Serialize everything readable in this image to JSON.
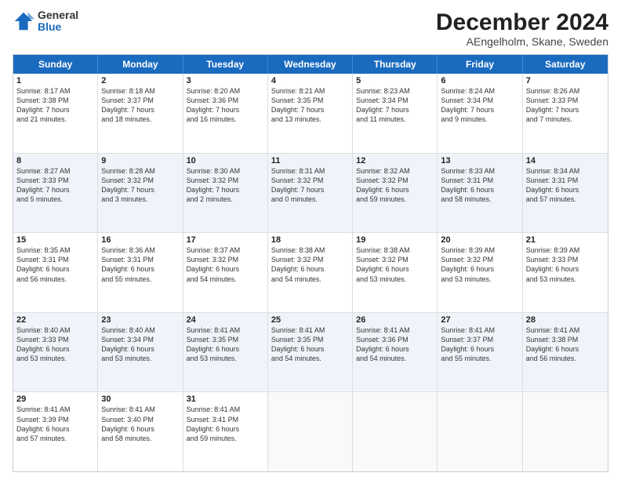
{
  "logo": {
    "general": "General",
    "blue": "Blue"
  },
  "title": "December 2024",
  "subtitle": "AEngelholm, Skane, Sweden",
  "header_days": [
    "Sunday",
    "Monday",
    "Tuesday",
    "Wednesday",
    "Thursday",
    "Friday",
    "Saturday"
  ],
  "weeks": [
    [
      {
        "day": "1",
        "lines": [
          "Sunrise: 8:17 AM",
          "Sunset: 3:38 PM",
          "Daylight: 7 hours",
          "and 21 minutes."
        ]
      },
      {
        "day": "2",
        "lines": [
          "Sunrise: 8:18 AM",
          "Sunset: 3:37 PM",
          "Daylight: 7 hours",
          "and 18 minutes."
        ]
      },
      {
        "day": "3",
        "lines": [
          "Sunrise: 8:20 AM",
          "Sunset: 3:36 PM",
          "Daylight: 7 hours",
          "and 16 minutes."
        ]
      },
      {
        "day": "4",
        "lines": [
          "Sunrise: 8:21 AM",
          "Sunset: 3:35 PM",
          "Daylight: 7 hours",
          "and 13 minutes."
        ]
      },
      {
        "day": "5",
        "lines": [
          "Sunrise: 8:23 AM",
          "Sunset: 3:34 PM",
          "Daylight: 7 hours",
          "and 11 minutes."
        ]
      },
      {
        "day": "6",
        "lines": [
          "Sunrise: 8:24 AM",
          "Sunset: 3:34 PM",
          "Daylight: 7 hours",
          "and 9 minutes."
        ]
      },
      {
        "day": "7",
        "lines": [
          "Sunrise: 8:26 AM",
          "Sunset: 3:33 PM",
          "Daylight: 7 hours",
          "and 7 minutes."
        ]
      }
    ],
    [
      {
        "day": "8",
        "lines": [
          "Sunrise: 8:27 AM",
          "Sunset: 3:33 PM",
          "Daylight: 7 hours",
          "and 5 minutes."
        ]
      },
      {
        "day": "9",
        "lines": [
          "Sunrise: 8:28 AM",
          "Sunset: 3:32 PM",
          "Daylight: 7 hours",
          "and 3 minutes."
        ]
      },
      {
        "day": "10",
        "lines": [
          "Sunrise: 8:30 AM",
          "Sunset: 3:32 PM",
          "Daylight: 7 hours",
          "and 2 minutes."
        ]
      },
      {
        "day": "11",
        "lines": [
          "Sunrise: 8:31 AM",
          "Sunset: 3:32 PM",
          "Daylight: 7 hours",
          "and 0 minutes."
        ]
      },
      {
        "day": "12",
        "lines": [
          "Sunrise: 8:32 AM",
          "Sunset: 3:32 PM",
          "Daylight: 6 hours",
          "and 59 minutes."
        ]
      },
      {
        "day": "13",
        "lines": [
          "Sunrise: 8:33 AM",
          "Sunset: 3:31 PM",
          "Daylight: 6 hours",
          "and 58 minutes."
        ]
      },
      {
        "day": "14",
        "lines": [
          "Sunrise: 8:34 AM",
          "Sunset: 3:31 PM",
          "Daylight: 6 hours",
          "and 57 minutes."
        ]
      }
    ],
    [
      {
        "day": "15",
        "lines": [
          "Sunrise: 8:35 AM",
          "Sunset: 3:31 PM",
          "Daylight: 6 hours",
          "and 56 minutes."
        ]
      },
      {
        "day": "16",
        "lines": [
          "Sunrise: 8:36 AM",
          "Sunset: 3:31 PM",
          "Daylight: 6 hours",
          "and 55 minutes."
        ]
      },
      {
        "day": "17",
        "lines": [
          "Sunrise: 8:37 AM",
          "Sunset: 3:32 PM",
          "Daylight: 6 hours",
          "and 54 minutes."
        ]
      },
      {
        "day": "18",
        "lines": [
          "Sunrise: 8:38 AM",
          "Sunset: 3:32 PM",
          "Daylight: 6 hours",
          "and 54 minutes."
        ]
      },
      {
        "day": "19",
        "lines": [
          "Sunrise: 8:38 AM",
          "Sunset: 3:32 PM",
          "Daylight: 6 hours",
          "and 53 minutes."
        ]
      },
      {
        "day": "20",
        "lines": [
          "Sunrise: 8:39 AM",
          "Sunset: 3:32 PM",
          "Daylight: 6 hours",
          "and 53 minutes."
        ]
      },
      {
        "day": "21",
        "lines": [
          "Sunrise: 8:39 AM",
          "Sunset: 3:33 PM",
          "Daylight: 6 hours",
          "and 53 minutes."
        ]
      }
    ],
    [
      {
        "day": "22",
        "lines": [
          "Sunrise: 8:40 AM",
          "Sunset: 3:33 PM",
          "Daylight: 6 hours",
          "and 53 minutes."
        ]
      },
      {
        "day": "23",
        "lines": [
          "Sunrise: 8:40 AM",
          "Sunset: 3:34 PM",
          "Daylight: 6 hours",
          "and 53 minutes."
        ]
      },
      {
        "day": "24",
        "lines": [
          "Sunrise: 8:41 AM",
          "Sunset: 3:35 PM",
          "Daylight: 6 hours",
          "and 53 minutes."
        ]
      },
      {
        "day": "25",
        "lines": [
          "Sunrise: 8:41 AM",
          "Sunset: 3:35 PM",
          "Daylight: 6 hours",
          "and 54 minutes."
        ]
      },
      {
        "day": "26",
        "lines": [
          "Sunrise: 8:41 AM",
          "Sunset: 3:36 PM",
          "Daylight: 6 hours",
          "and 54 minutes."
        ]
      },
      {
        "day": "27",
        "lines": [
          "Sunrise: 8:41 AM",
          "Sunset: 3:37 PM",
          "Daylight: 6 hours",
          "and 55 minutes."
        ]
      },
      {
        "day": "28",
        "lines": [
          "Sunrise: 8:41 AM",
          "Sunset: 3:38 PM",
          "Daylight: 6 hours",
          "and 56 minutes."
        ]
      }
    ],
    [
      {
        "day": "29",
        "lines": [
          "Sunrise: 8:41 AM",
          "Sunset: 3:39 PM",
          "Daylight: 6 hours",
          "and 57 minutes."
        ]
      },
      {
        "day": "30",
        "lines": [
          "Sunrise: 8:41 AM",
          "Sunset: 3:40 PM",
          "Daylight: 6 hours",
          "and 58 minutes."
        ]
      },
      {
        "day": "31",
        "lines": [
          "Sunrise: 8:41 AM",
          "Sunset: 3:41 PM",
          "Daylight: 6 hours",
          "and 59 minutes."
        ]
      },
      {
        "day": "",
        "lines": []
      },
      {
        "day": "",
        "lines": []
      },
      {
        "day": "",
        "lines": []
      },
      {
        "day": "",
        "lines": []
      }
    ]
  ]
}
